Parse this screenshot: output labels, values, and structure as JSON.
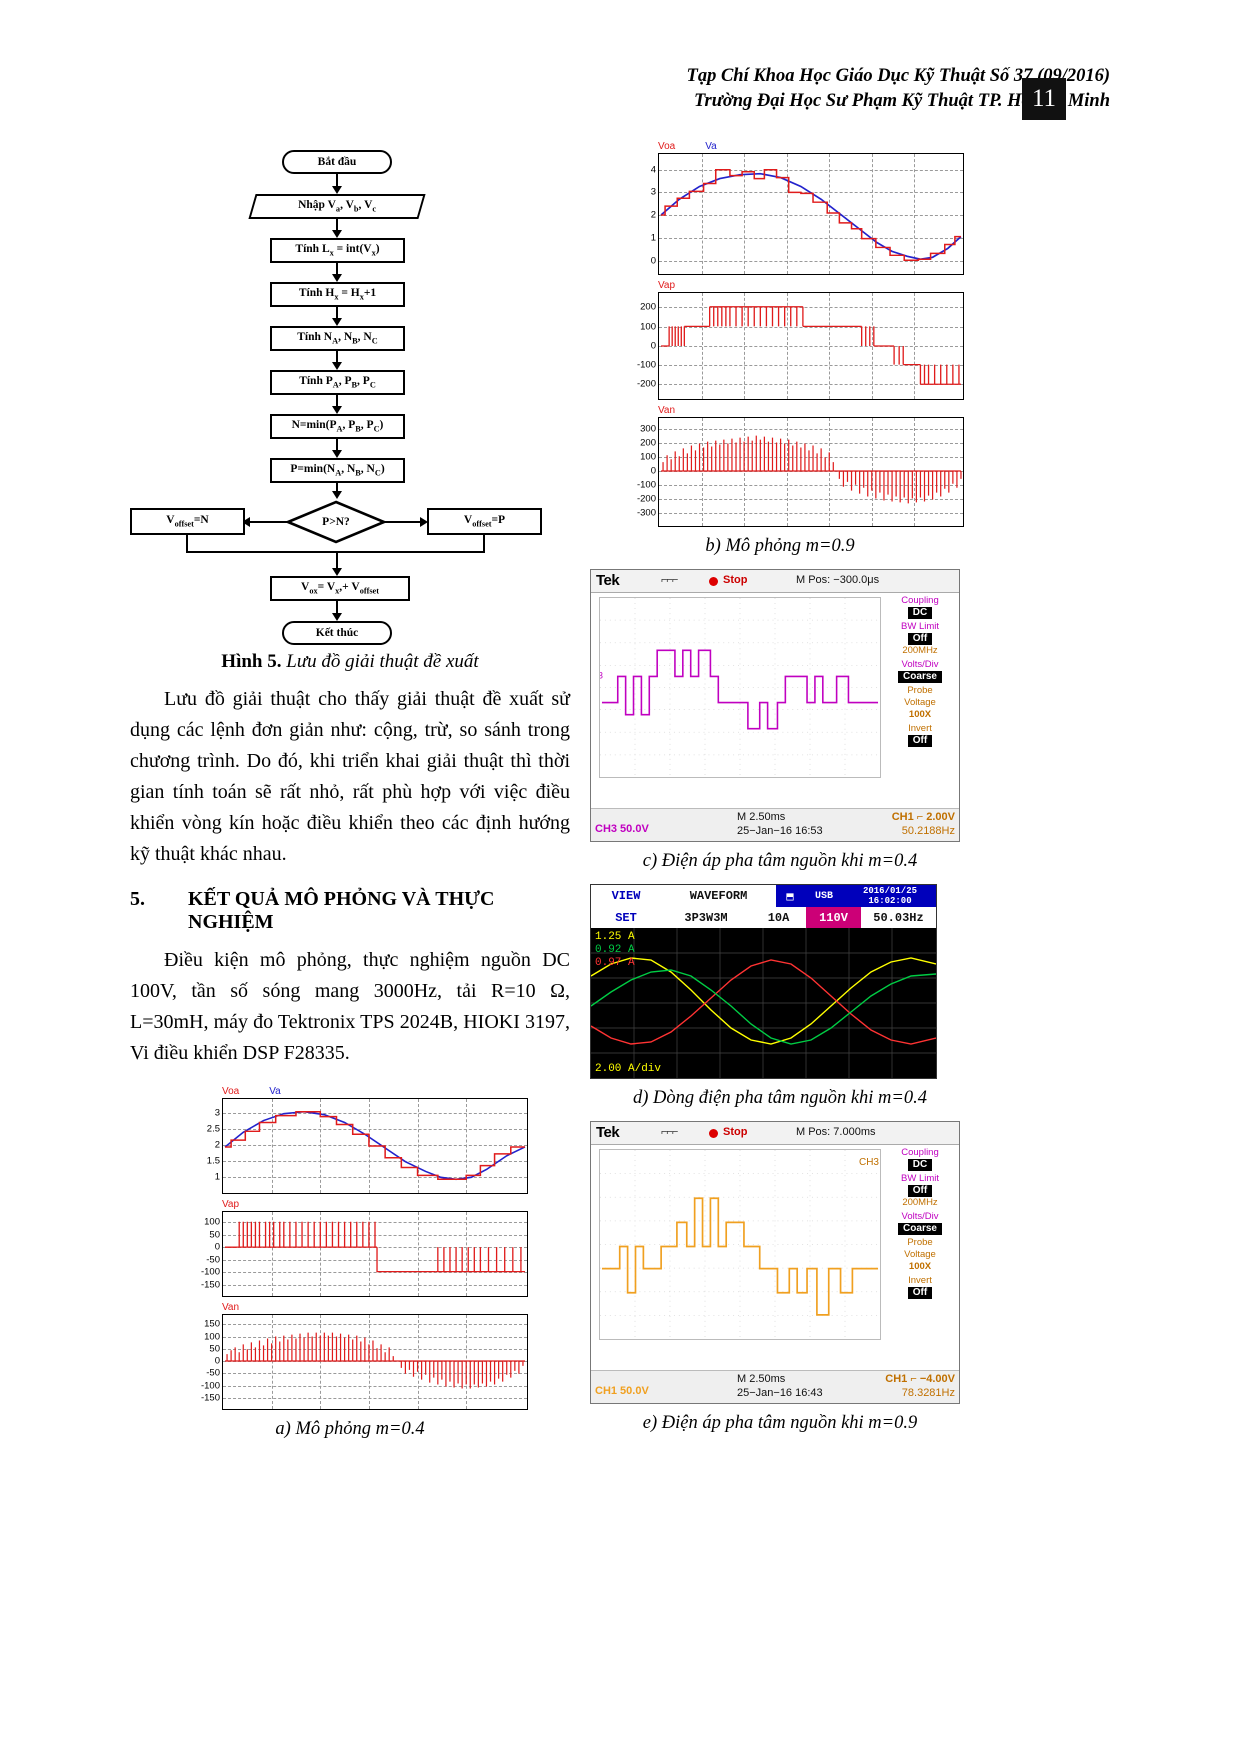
{
  "header": {
    "line1": "Tạp Chí Khoa Học Giáo Dục Kỹ Thuật Số 37 (09/2016)",
    "line2": "Trường Đại Học Sư Phạm Kỹ Thuật TP. Hồ Chí Minh",
    "page_number": "11"
  },
  "flowchart": {
    "caption_label": "Hình 5.",
    "caption_text": "Lưu đồ giải thuật đề xuất",
    "nodes": [
      {
        "id": "start",
        "text": "Bắt đầu",
        "shape": "terminator"
      },
      {
        "id": "input",
        "text": "Nhập Va, Vb, Vc",
        "shape": "io"
      },
      {
        "id": "lx",
        "text": "Tính Lx = int(Vx)",
        "shape": "process"
      },
      {
        "id": "hx",
        "text": "Tính Hx = Hx+1",
        "shape": "process"
      },
      {
        "id": "n",
        "text": "Tính NA, NB, NC",
        "shape": "process"
      },
      {
        "id": "p",
        "text": "Tính PA, PB, PC",
        "shape": "process"
      },
      {
        "id": "nmin",
        "text": "N=min(PA, PB, PC)",
        "shape": "process"
      },
      {
        "id": "pmin",
        "text": "P=min(NA, NB, NC)",
        "shape": "process"
      },
      {
        "id": "dec",
        "text": "P>N?",
        "shape": "decision"
      },
      {
        "id": "offn",
        "text": "Voffset=N",
        "shape": "process"
      },
      {
        "id": "offp",
        "text": "Voffset=P",
        "shape": "process"
      },
      {
        "id": "vox",
        "text": "Vox= Vx,+ Voffset",
        "shape": "process"
      },
      {
        "id": "end",
        "text": "Kết thúc",
        "shape": "terminator"
      }
    ]
  },
  "paragraphs": {
    "p1": "Lưu đồ giải thuật cho thấy giải thuật đề xuất sử dụng các lệnh đơn giản như: cộng, trừ, so sánh trong chương trình. Do đó, khi triển khai giải thuật thì thời gian tính toán sẽ rất nhỏ, rất phù hợp với việc điều khiển vòng kín hoặc điều khiển theo các định hướng kỹ thuật khác nhau.",
    "p2": "Điều kiện mô phỏng, thực nghiệm nguồn DC 100V, tần số sóng mang 3000Hz, tải R=10 Ω, L=30mH, máy đo Tektronix TPS 2024B, HIOKI 3197, Vi điều khiển DSP F28335."
  },
  "section": {
    "number": "5.",
    "title": "KẾT QUẢ MÔ PHỎNG VÀ THỰC NGHIỆM"
  },
  "captions": {
    "a": "a) Mô phỏng m=0.4",
    "b": "b) Mô phỏng m=0.9",
    "c": "c) Điện áp pha tâm nguồn khi m=0.4",
    "d": "d) Dòng điện pha tâm nguồn khi m=0.4",
    "e": "e) Điện áp pha tâm nguồn khi m=0.9"
  },
  "colors": {
    "red": "#e01b1b",
    "blue": "#2222cc",
    "purple": "#c000c0",
    "orange": "#f0a020",
    "hioki_blue": "#0000bb",
    "hioki_magenta": "#cc0077",
    "yellow": "#ffff00"
  },
  "chart_data": [
    {
      "id": "fig_b",
      "type": "line",
      "title": "b) Mô phỏng m=0.9",
      "grid": true,
      "panels": [
        {
          "name": "panel-voa-va",
          "series": [
            {
              "name": "Voa",
              "color": "#e01b1b",
              "style": "stepped"
            },
            {
              "name": "Va",
              "color": "#2222cc",
              "style": "smooth"
            }
          ],
          "yticks": [
            0,
            1,
            2,
            3,
            4
          ],
          "ylim": [
            -0.3,
            4.4
          ],
          "ylabel": "",
          "xlabel": ""
        },
        {
          "name": "panel-vap",
          "series": [
            {
              "name": "Vap",
              "color": "#e01b1b",
              "style": "pwm"
            }
          ],
          "yticks": [
            -200,
            -100,
            0,
            100,
            200
          ],
          "ylim": [
            -250,
            250
          ]
        },
        {
          "name": "panel-van",
          "series": [
            {
              "name": "Van",
              "color": "#e01b1b",
              "style": "pwm"
            }
          ],
          "yticks": [
            -300,
            -200,
            -100,
            0,
            100,
            200,
            300
          ],
          "ylim": [
            -330,
            330
          ]
        }
      ]
    },
    {
      "id": "fig_a",
      "type": "line",
      "title": "a) Mô phỏng m=0.4",
      "grid": true,
      "panels": [
        {
          "name": "panel-voa-va",
          "series": [
            {
              "name": "Voa",
              "color": "#e01b1b",
              "style": "stepped"
            },
            {
              "name": "Va",
              "color": "#2222cc",
              "style": "smooth"
            }
          ],
          "yticks": [
            1,
            1.5,
            2,
            2.5,
            3
          ],
          "ylim": [
            0.8,
            3.3
          ]
        },
        {
          "name": "panel-vap",
          "series": [
            {
              "name": "Vap",
              "color": "#e01b1b",
              "style": "pwm"
            }
          ],
          "yticks": [
            -150,
            -100,
            -50,
            0,
            50,
            100
          ],
          "ylim": [
            -170,
            130
          ]
        },
        {
          "name": "panel-van",
          "series": [
            {
              "name": "Van",
              "color": "#e01b1b",
              "style": "pwm"
            }
          ],
          "yticks": [
            -150,
            -100,
            -50,
            0,
            50,
            100,
            150
          ],
          "ylim": [
            -170,
            170
          ]
        }
      ]
    }
  ],
  "scope_c": {
    "brand": "Tek",
    "run_state": "Stop",
    "m_pos": "M Pos: −300.0μs",
    "channel": "CH1",
    "menu": [
      {
        "label": "Coupling",
        "value": "DC"
      },
      {
        "label": "BW Limit",
        "value": "Off",
        "sub": "200MHz"
      },
      {
        "label": "Volts/Div",
        "value": "Coarse"
      },
      {
        "label": "Probe",
        "value": "100X",
        "sub": "Voltage"
      },
      {
        "label": "Invert",
        "value": "Off"
      }
    ],
    "bottom_left": "CH3  50.0V",
    "bottom_mid": "M 2.50ms",
    "bottom_date": "25−Jan−16 16:53",
    "bottom_right": "CH1 ⌐ 2.00V",
    "bottom_freq": "50.2188Hz",
    "trace_color": "#c000c0"
  },
  "scope_e": {
    "brand": "Tek",
    "run_state": "Stop",
    "m_pos": "M Pos: 7.000ms",
    "channel": "CH3",
    "menu": [
      {
        "label": "Coupling",
        "value": "DC"
      },
      {
        "label": "BW Limit",
        "value": "Off",
        "sub": "200MHz"
      },
      {
        "label": "Volts/Div",
        "value": "Coarse"
      },
      {
        "label": "Probe",
        "value": "100X",
        "sub": "Voltage"
      },
      {
        "label": "Invert",
        "value": "Off"
      }
    ],
    "bottom_left": "CH1  50.0V",
    "bottom_mid": "M 2.50ms",
    "bottom_date": "25−Jan−16 16:43",
    "bottom_right": "CH1 ⌐ −4.00V",
    "bottom_freq": "78.3281Hz",
    "trace_color": "#f0a020"
  },
  "hioki": {
    "row1": {
      "view": "VIEW",
      "waveform": "WAVEFORM",
      "usb": "USB",
      "date": "2016/01/25",
      "time": "16:02:00"
    },
    "row2": {
      "set": "SET",
      "wiring": "3P3W3M",
      "current": "10A",
      "voltage": "110V",
      "freq": "50.03Hz"
    },
    "values": [
      {
        "text": "1.25 A",
        "color": "#ffff00"
      },
      {
        "text": "0.92 A",
        "color": "#00cc44"
      },
      {
        "text": "0.97 A",
        "color": "#ff3333"
      }
    ],
    "scale": "2.00 A/div"
  }
}
